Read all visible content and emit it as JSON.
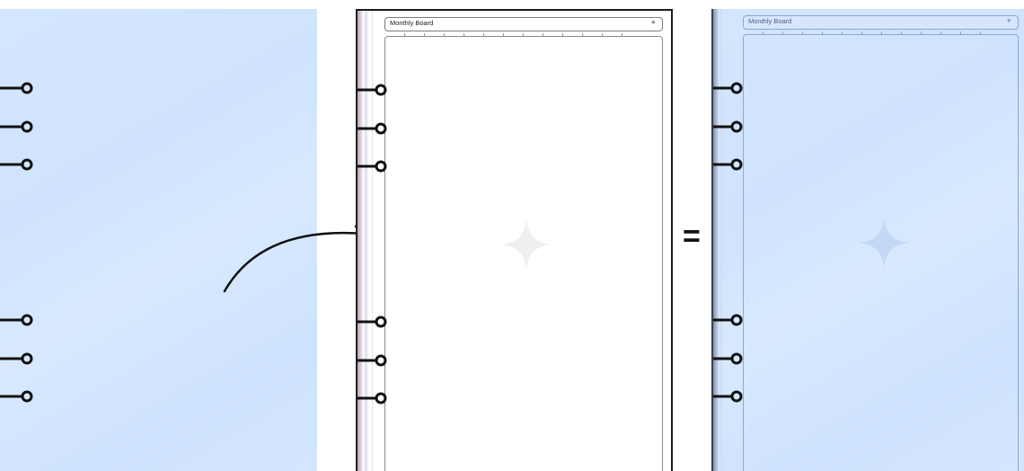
{
  "left_panel": {
    "description": ""
  },
  "middle_panel": {
    "header": {
      "title": "Monthly Board"
    }
  },
  "right_panel": {
    "header": {
      "title": "Monthly Board"
    }
  },
  "operator": "=",
  "colors": {
    "cover_blue": "#d2e5fd",
    "page_white": "#ffffff",
    "ring_black": "#111111",
    "star_gray": "#f0f0f0",
    "star_blue": "#c0d7f5"
  },
  "icons": {
    "header_star": "sparkle-icon",
    "center_star": "sparkle-icon",
    "rings": "binder-ring-icon",
    "arrow": "curved-arrow-icon"
  }
}
